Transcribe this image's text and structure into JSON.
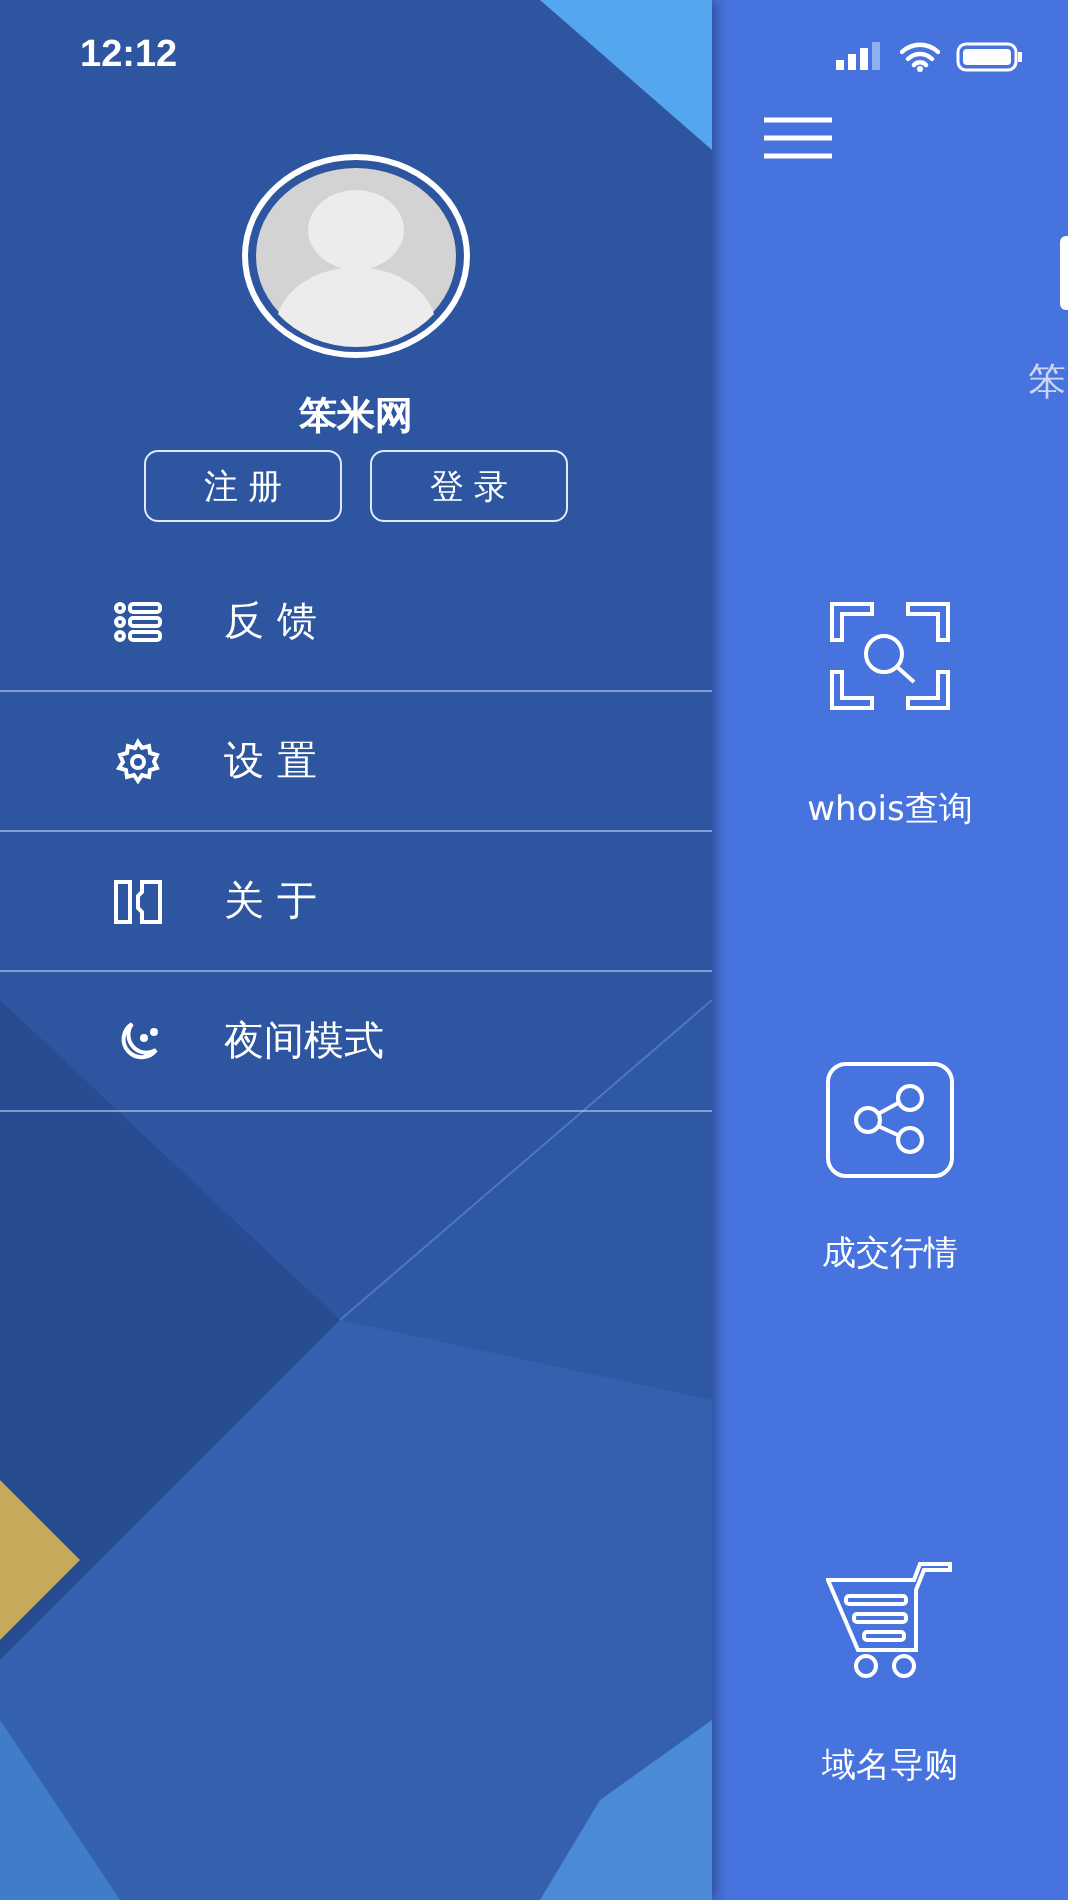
{
  "status_bar": {
    "time": "12:12"
  },
  "drawer": {
    "user_name": "笨米网",
    "buttons": [
      "注 册",
      "登 录"
    ],
    "menu": [
      {
        "label": "反 馈"
      },
      {
        "label": "设 置"
      },
      {
        "label": "关 于"
      },
      {
        "label": "夜间模式"
      }
    ]
  },
  "main": {
    "subtitle_fragment": "笨",
    "features": [
      {
        "label": "whois查询"
      },
      {
        "label": "成交行情"
      },
      {
        "label": "域名导购"
      }
    ]
  }
}
